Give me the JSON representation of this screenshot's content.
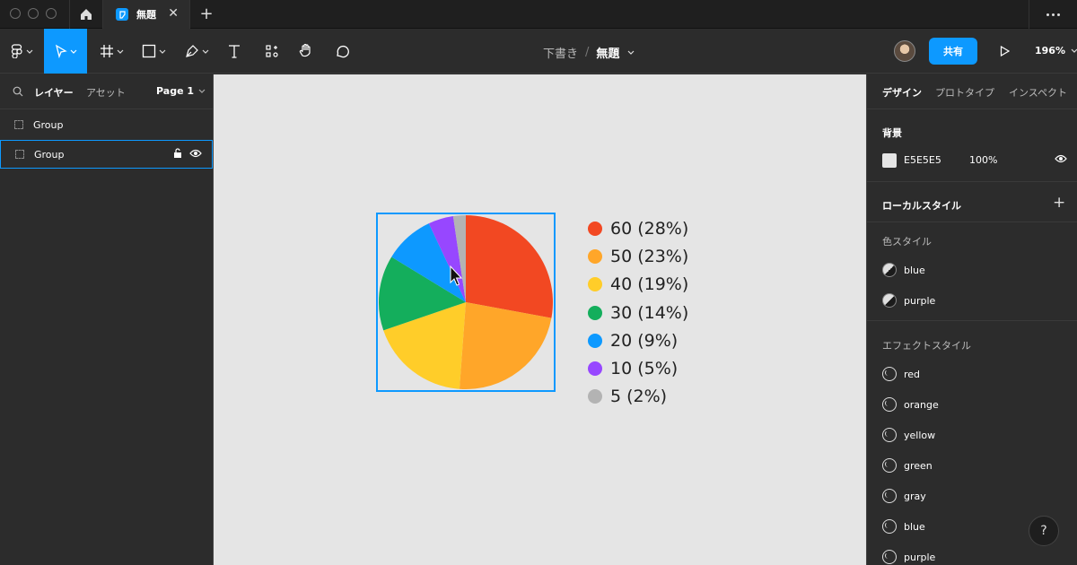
{
  "titlebar": {
    "file_tab_label": "無題",
    "close_glyph": "✕",
    "new_tab_glyph": "+"
  },
  "toolbar": {
    "breadcrumb_parent": "下書き",
    "breadcrumb_separator": "/",
    "file_name": "無題",
    "share_label": "共有",
    "zoom": "196%",
    "tools": [
      "main-menu",
      "move",
      "frame",
      "shape",
      "pen",
      "text",
      "resources",
      "hand",
      "comment"
    ]
  },
  "left_panel": {
    "tab_layers": "レイヤー",
    "tab_assets": "アセット",
    "page_label": "Page 1",
    "layers": [
      {
        "label": "Group",
        "selected": false
      },
      {
        "label": "Group",
        "selected": true
      }
    ]
  },
  "chart_data": {
    "type": "pie",
    "values": [
      60,
      50,
      40,
      30,
      20,
      10,
      5
    ],
    "labels": [
      "60 (28%)",
      "50 (23%)",
      "40 (19%)",
      "30 (14%)",
      "20 (9%)",
      "10 (5%)",
      "5 (2%)"
    ],
    "colors": [
      "#f24822",
      "#ffa629",
      "#ffcd29",
      "#14ae5c",
      "#0d99ff",
      "#9747ff",
      "#b3b3b3"
    ]
  },
  "right_panel": {
    "tab_design": "デザイン",
    "tab_prototype": "プロトタイプ",
    "tab_inspect": "インスペクト",
    "background_title": "背景",
    "background_hex": "E5E5E5",
    "background_opacity": "100%",
    "local_styles_title": "ローカルスタイル",
    "add_glyph": "+",
    "color_styles_title": "色スタイル",
    "color_styles": [
      "blue",
      "purple"
    ],
    "effect_styles_title": "エフェクトスタイル",
    "effect_styles": [
      "red",
      "orange",
      "yellow",
      "green",
      "gray",
      "blue",
      "purple"
    ]
  },
  "help_label": "?"
}
